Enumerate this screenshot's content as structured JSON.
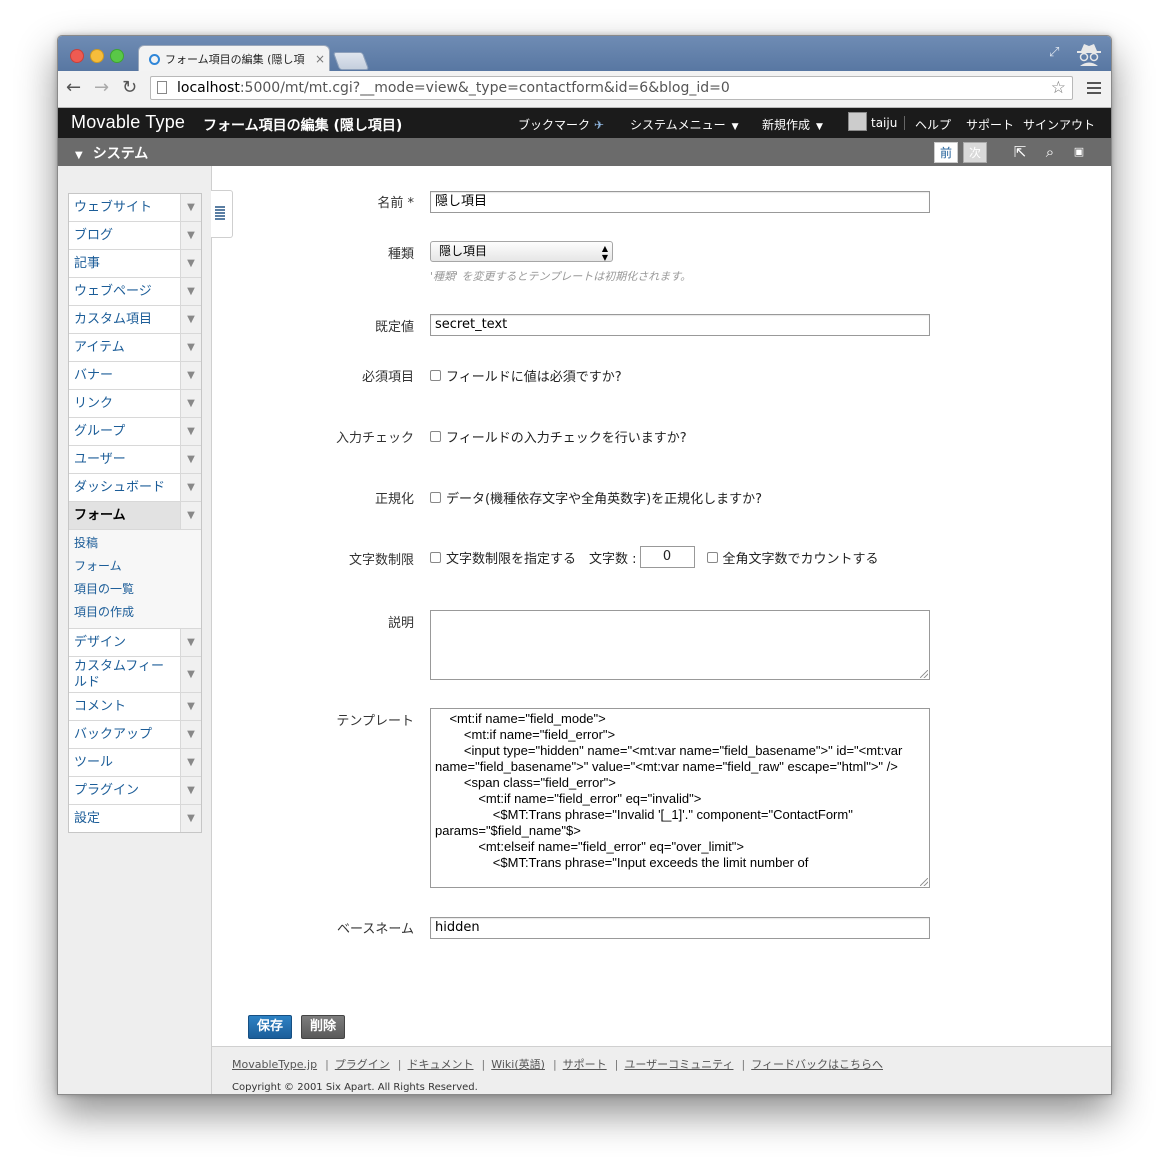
{
  "browser": {
    "tab_title": "フォーム項目の編集 (隠し項",
    "tab_close": "×",
    "url_host": "localhost",
    "url_rest": ":5000/mt/mt.cgi?__mode=view&_type=contactform&id=6&blog_id=0"
  },
  "header": {
    "brand": "Movable Type",
    "page_title": "フォーム項目の編集 (隠し項目)",
    "nav": {
      "bookmark": "ブックマーク",
      "system_menu": "システムメニュー",
      "new": "新規作成",
      "user": "taiju",
      "help": "ヘルプ",
      "support": "サポート",
      "signout": "サインアウト"
    }
  },
  "scope": {
    "title": "システム",
    "prev": "前",
    "next": "次"
  },
  "sidebar": {
    "items": [
      {
        "label": "ウェブサイト"
      },
      {
        "label": "ブログ"
      },
      {
        "label": "記事"
      },
      {
        "label": "ウェブページ"
      },
      {
        "label": "カスタム項目"
      },
      {
        "label": "アイテム"
      },
      {
        "label": "バナー"
      },
      {
        "label": "リンク"
      },
      {
        "label": "グループ"
      },
      {
        "label": "ユーザー"
      },
      {
        "label": "ダッシュボード"
      },
      {
        "label": "フォーム"
      }
    ],
    "submenu": [
      "投稿",
      "フォーム",
      "項目の一覧",
      "項目の作成"
    ],
    "items_after": [
      {
        "label": "デザイン"
      },
      {
        "label": "カスタムフィールド"
      },
      {
        "label": "コメント"
      },
      {
        "label": "バックアップ"
      },
      {
        "label": "ツール"
      },
      {
        "label": "プラグイン"
      },
      {
        "label": "設定"
      }
    ]
  },
  "form": {
    "name_label": "名前 *",
    "name_value": "隠し項目",
    "type_label": "種類",
    "type_value": "隠し項目",
    "type_hint": "'種類' を変更するとテンプレートは初期化されます。",
    "default_label": "既定値",
    "default_value": "secret_text",
    "required_label": "必須項目",
    "required_check": "フィールドに値は必須ですか?",
    "validate_label": "入力チェック",
    "validate_check": "フィールドの入力チェックを行いますか?",
    "normalize_label": "正規化",
    "normalize_check": "データ(機種依存文字や全角英数字)を正規化しますか?",
    "limit_label": "文字数制限",
    "limit_check": "文字数制限を指定する",
    "limit_count_label": "文字数 :",
    "limit_count_value": "0",
    "limit_fullwidth_check": "全角文字数でカウントする",
    "description_label": "説明",
    "description_value": "",
    "template_label": "テンプレート",
    "template_value": "    <mt:if name=\"field_mode\">\n        <mt:if name=\"field_error\">\n        <input type=\"hidden\" name=\"<mt:var name=\"field_basename\">\" id=\"<mt:var name=\"field_basename\">\" value=\"<mt:var name=\"field_raw\" escape=\"html\">\" />\n        <span class=\"field_error\">\n            <mt:if name=\"field_error\" eq=\"invalid\">\n                <$MT:Trans phrase=\"Invalid '[_1]'.\" component=\"ContactForm\" params=\"$field_name\"$>\n            <mt:elseif name=\"field_error\" eq=\"over_limit\">\n                <$MT:Trans phrase=\"Input exceeds the limit number of",
    "basename_label": "ベースネーム",
    "basename_value": "hidden",
    "save_button": "保存",
    "delete_button": "削除"
  },
  "footer": {
    "links": [
      "MovableType.jp",
      "プラグイン",
      "ドキュメント",
      "Wiki(英語)",
      "サポート",
      "ユーザーコミュニティ",
      "フィードバックはこちらへ"
    ],
    "copyright": "Copyright © 2001 Six Apart. All Rights Reserved."
  }
}
